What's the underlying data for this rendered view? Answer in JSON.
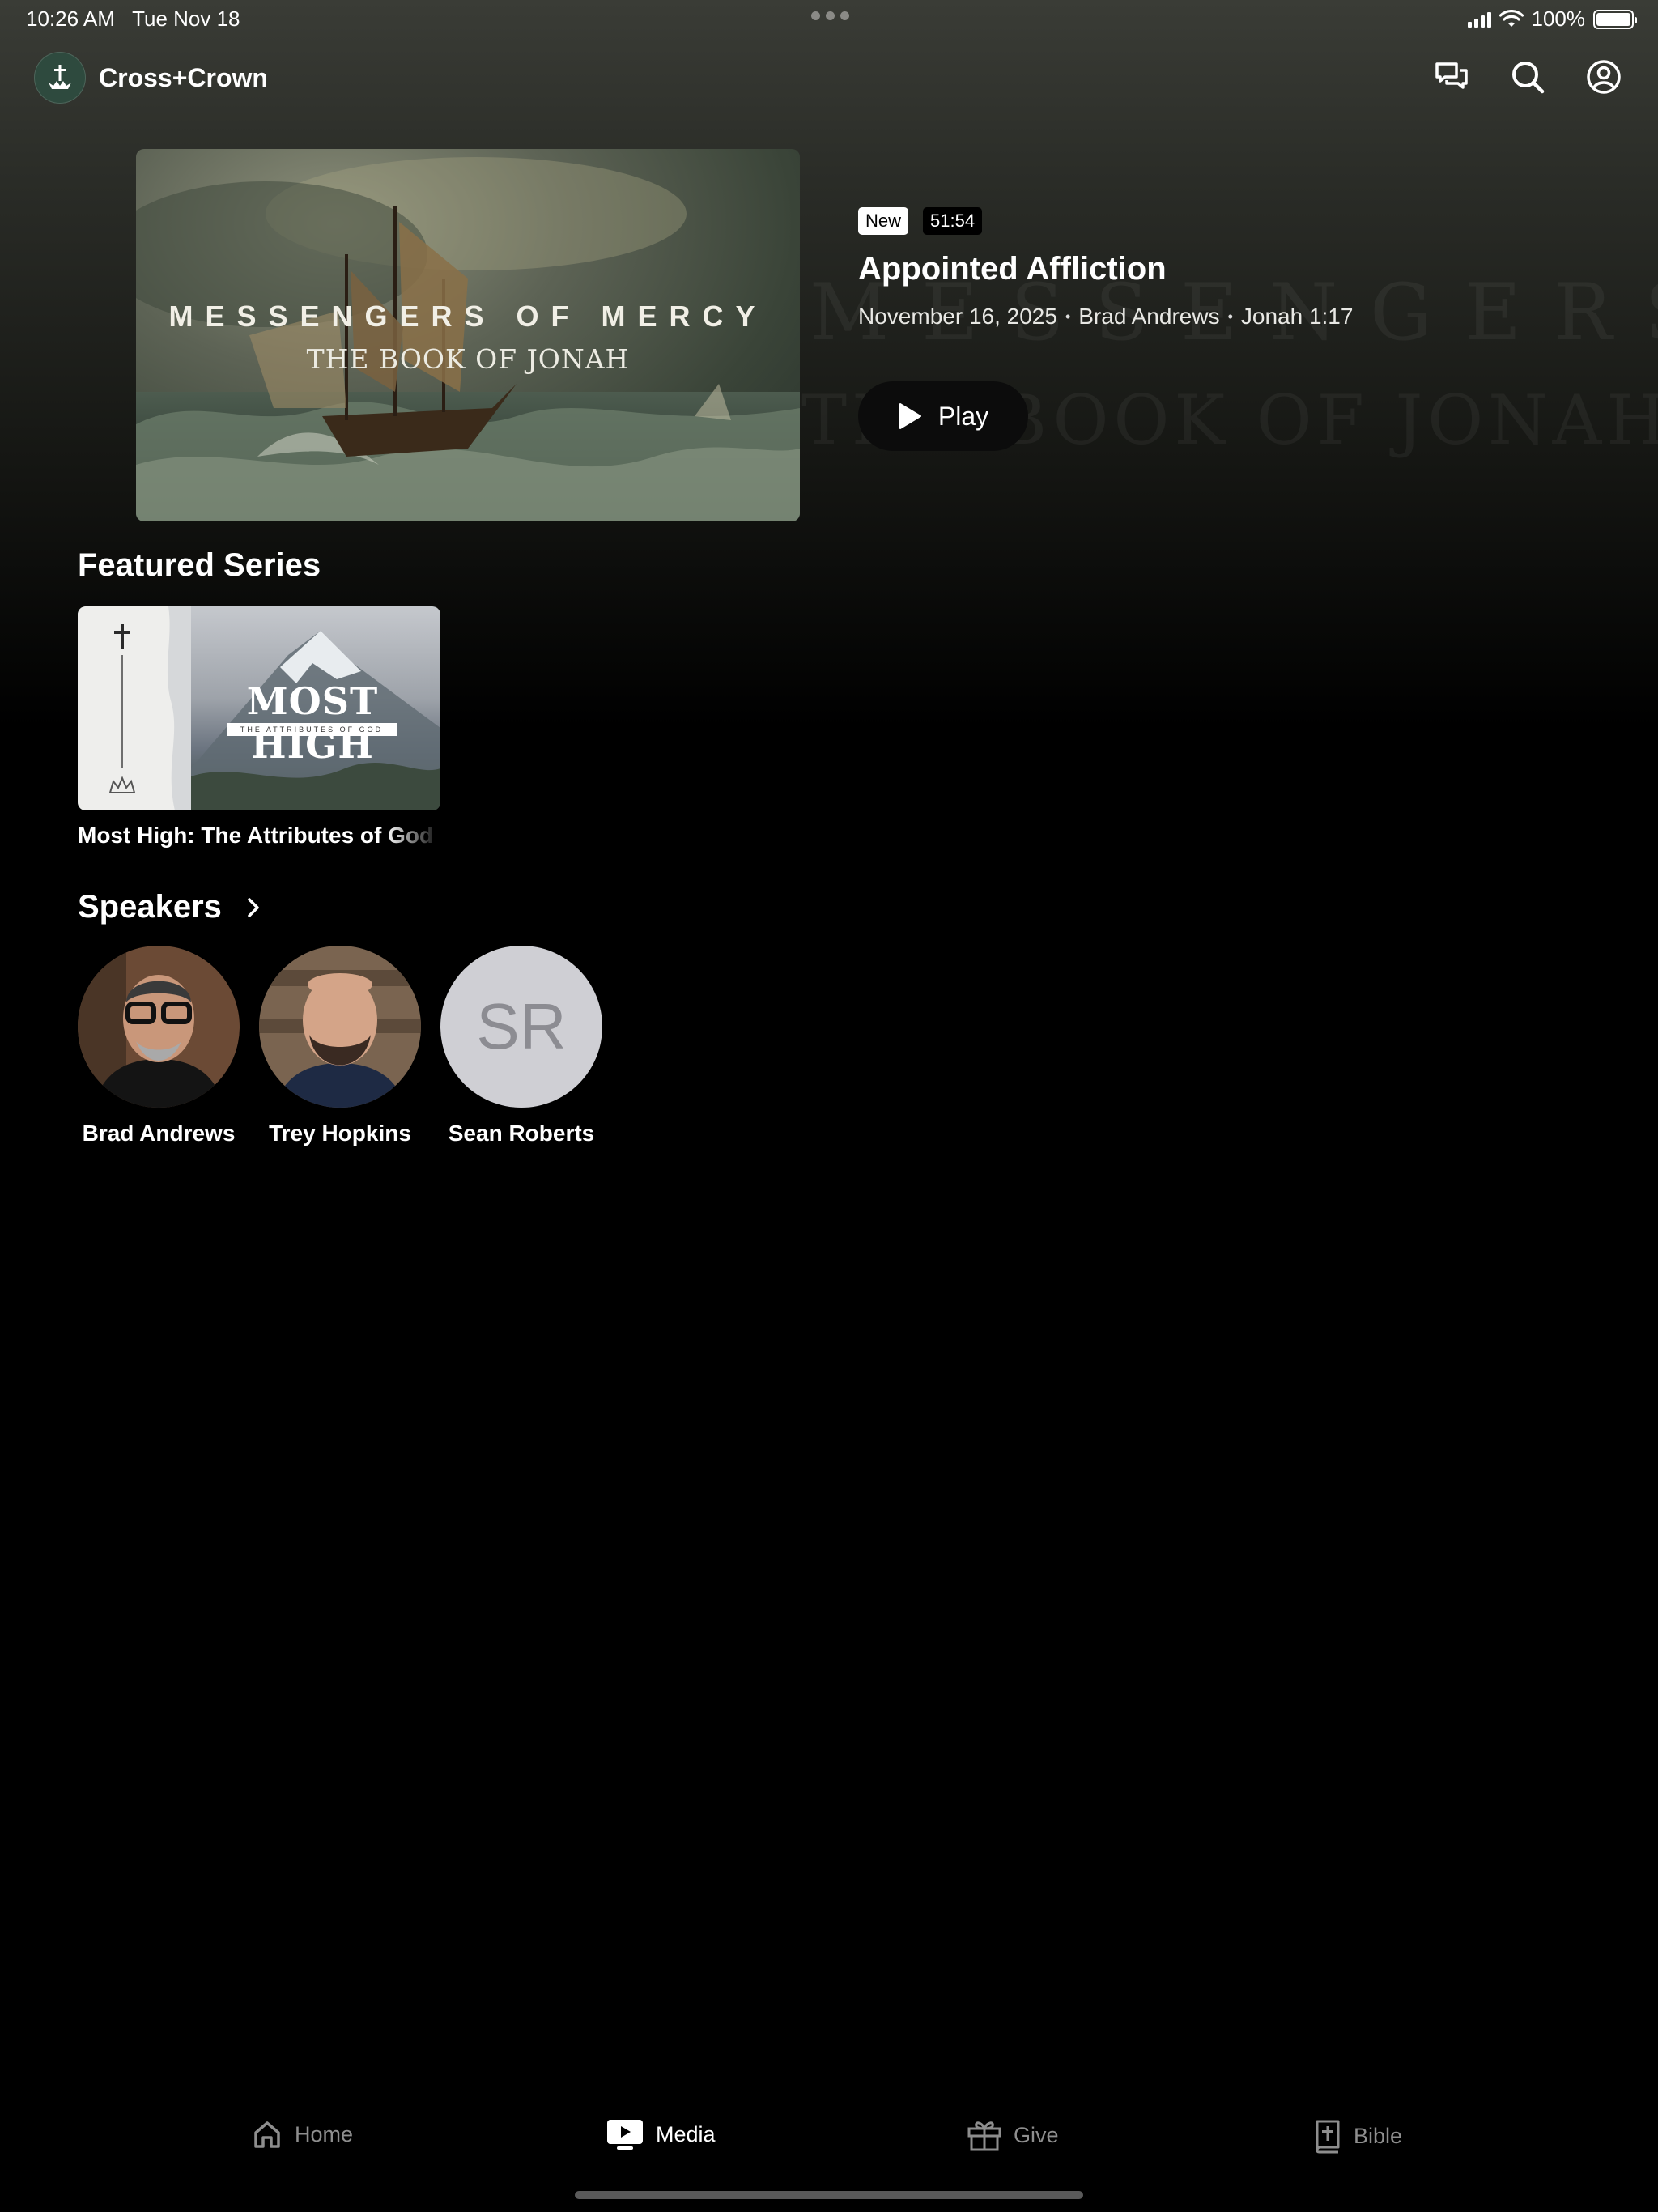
{
  "status": {
    "time": "10:26 AM",
    "date": "Tue Nov 18",
    "battery": "100%"
  },
  "header": {
    "app_name": "Cross+Crown",
    "icons": [
      "chat-icon",
      "search-icon",
      "account-icon"
    ]
  },
  "hero": {
    "thumb_title": "MESSENGERS OF MERCY",
    "thumb_subtitle": "THE BOOK OF JONAH",
    "badge_new": "New",
    "duration": "51:54",
    "title": "Appointed Affliction",
    "date": "November 16, 2025",
    "speaker": "Brad Andrews",
    "passage": "Jonah 1:17",
    "play_label": "Play"
  },
  "featured": {
    "section_title": "Featured Series",
    "series": [
      {
        "card_title": "MOST HIGH",
        "card_subtitle": "THE ATTRIBUTES OF GOD",
        "label": "Most High: The Attributes of God"
      }
    ]
  },
  "speakers": {
    "section_title": "Speakers",
    "items": [
      {
        "name": "Brad Andrews",
        "initials": ""
      },
      {
        "name": "Trey Hopkins",
        "initials": ""
      },
      {
        "name": "Sean Roberts",
        "initials": "SR"
      }
    ]
  },
  "tabs": [
    {
      "label": "Home",
      "icon": "home-icon",
      "active": false
    },
    {
      "label": "Media",
      "icon": "media-icon",
      "active": true
    },
    {
      "label": "Give",
      "icon": "gift-icon",
      "active": false
    },
    {
      "label": "Bible",
      "icon": "bible-icon",
      "active": false
    }
  ],
  "colors": {
    "background": "#000000",
    "header_gradient": "#3a3c36",
    "inactive_tab": "#8e8e8e"
  }
}
